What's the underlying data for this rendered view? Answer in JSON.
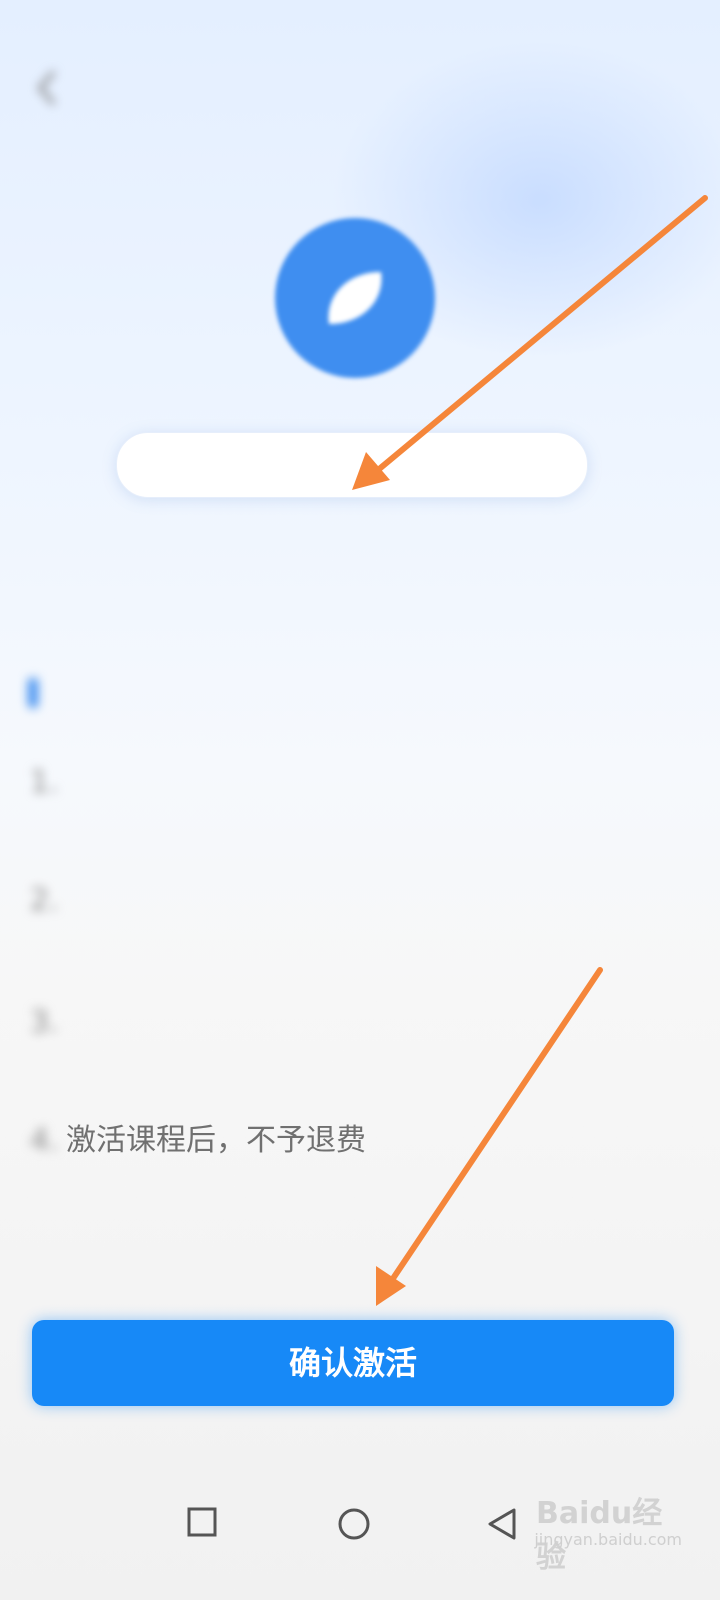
{
  "status_bar": {
    "time": "",
    "icons_label": ""
  },
  "header": {
    "title": "",
    "right_link": ""
  },
  "activation": {
    "code_placeholder": "",
    "error_text": ""
  },
  "rules": {
    "heading": "",
    "items": [
      {
        "num": "1.",
        "text": ""
      },
      {
        "num": "2.",
        "text": ""
      },
      {
        "num": "3.",
        "text": ""
      },
      {
        "num": "4.",
        "text": "激活课程后，不予退费"
      }
    ]
  },
  "confirm_button": {
    "label": "确认激活"
  },
  "watermark": {
    "main": "Baidu经验",
    "sub": "jingyan.baidu.com"
  },
  "colors": {
    "accent": "#1789f7",
    "logo": "#3f8ef0",
    "error": "#e25b6a",
    "annotation_arrow": "#f5863a"
  },
  "icons": {
    "back": "chevron-left-icon",
    "logo": "leaf-icon",
    "nav_recent": "square-icon",
    "nav_home": "circle-icon",
    "nav_back": "triangle-back-icon"
  }
}
